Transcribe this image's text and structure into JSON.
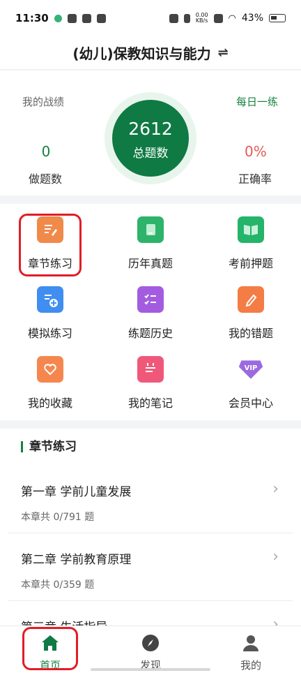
{
  "status_bar": {
    "time": "11:30",
    "speed_value": "0.00",
    "speed_unit": "KB/s",
    "battery": "43%"
  },
  "header": {
    "title": "(幼儿)保教知识与能力",
    "switch_icon": "⇌"
  },
  "stats": {
    "my_record_label": "我的战绩",
    "daily_practice_label": "每日一练",
    "total_questions": "2612",
    "total_questions_label": "总题数",
    "done_count": "0",
    "done_label": "做题数",
    "accuracy": "0%",
    "accuracy_label": "正确率"
  },
  "features": [
    {
      "label": "章节练习",
      "icon": "pencil-note-icon"
    },
    {
      "label": "历年真题",
      "icon": "book-stack-icon"
    },
    {
      "label": "考前押题",
      "icon": "open-book-icon"
    },
    {
      "label": "模拟练习",
      "icon": "document-plus-icon"
    },
    {
      "label": "练题历史",
      "icon": "checklist-icon"
    },
    {
      "label": "我的错题",
      "icon": "edit-icon"
    },
    {
      "label": "我的收藏",
      "icon": "heart-folder-icon"
    },
    {
      "label": "我的笔记",
      "icon": "calendar-note-icon"
    },
    {
      "label": "会员中心",
      "icon": "vip-icon",
      "badge": "VIP"
    }
  ],
  "chapter_section": {
    "title": "章节练习",
    "chapters": [
      {
        "title": "第一章 学前儿童发展",
        "count_prefix": "本章共",
        "count": "0/791",
        "count_suffix": "题"
      },
      {
        "title": "第二章 学前教育原理",
        "count_prefix": "本章共",
        "count": "0/359",
        "count_suffix": "题"
      },
      {
        "title": "第三章 生活指导"
      }
    ]
  },
  "tabbar": {
    "tabs": [
      {
        "label": "首页",
        "icon": "home-icon"
      },
      {
        "label": "发现",
        "icon": "compass-icon"
      },
      {
        "label": "我的",
        "icon": "user-icon"
      }
    ]
  },
  "colors": {
    "brand_green": "#0f7a43",
    "accent_red": "#e45b55",
    "highlight_red": "#e11d26"
  }
}
